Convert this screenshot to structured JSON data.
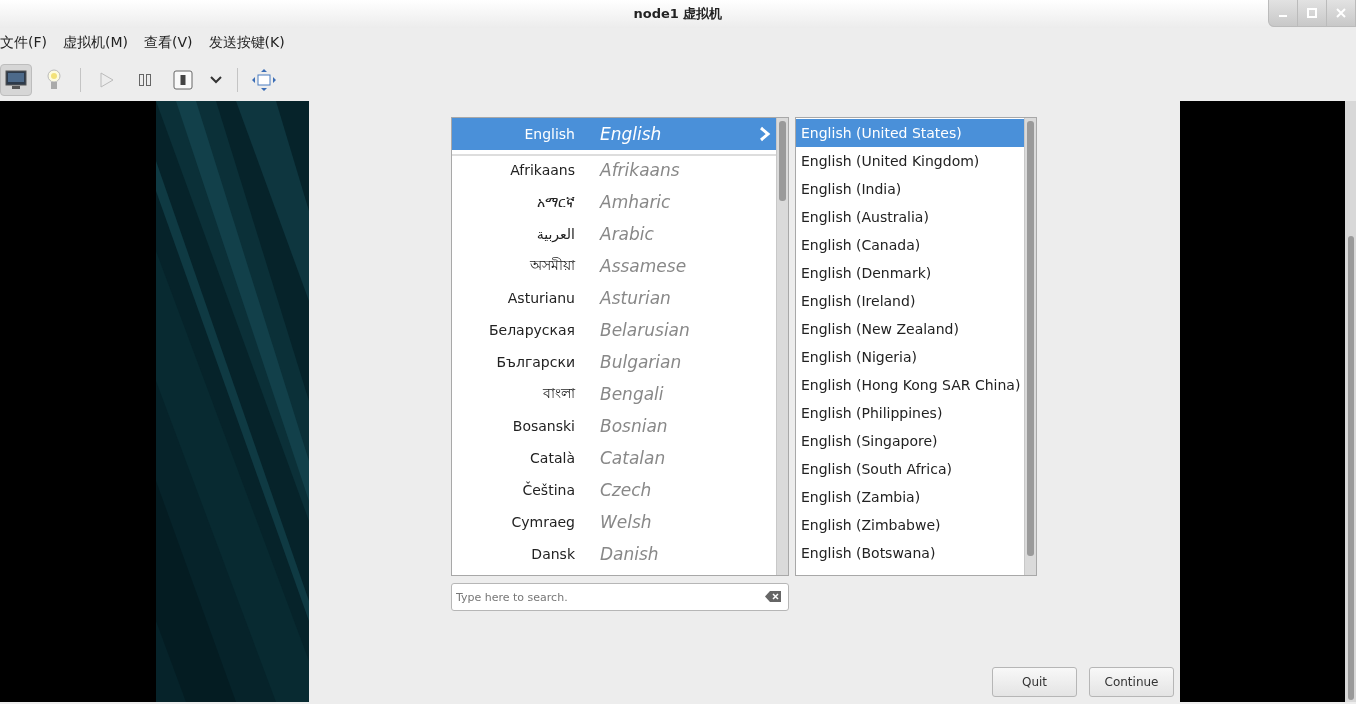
{
  "window": {
    "title": "node1 虚拟机"
  },
  "menu": [
    {
      "label": "文件(F)"
    },
    {
      "label": "虚拟机(M)"
    },
    {
      "label": "查看(V)"
    },
    {
      "label": "发送按键(K)"
    }
  ],
  "toolbar": [
    {
      "items": [
        {
          "kind": "monitor",
          "selected": true
        },
        {
          "kind": "bulb",
          "selected": false
        }
      ]
    },
    {
      "items": [
        {
          "kind": "play",
          "selected": false
        },
        {
          "kind": "pause",
          "selected": false
        },
        {
          "kind": "power",
          "selected": false
        },
        {
          "kind": "dropdown",
          "selected": false
        }
      ]
    },
    {
      "items": [
        {
          "kind": "fullscreen",
          "selected": false
        }
      ]
    }
  ],
  "languages": [
    {
      "native": "English",
      "english": "English",
      "selected": true
    },
    {
      "native": "Afrikaans",
      "english": "Afrikaans",
      "selected": false
    },
    {
      "native": "አማርኛ",
      "english": "Amharic",
      "selected": false
    },
    {
      "native": "العربية",
      "english": "Arabic",
      "selected": false
    },
    {
      "native": "অসমীয়া",
      "english": "Assamese",
      "selected": false
    },
    {
      "native": "Asturianu",
      "english": "Asturian",
      "selected": false
    },
    {
      "native": "Беларуская",
      "english": "Belarusian",
      "selected": false
    },
    {
      "native": "Български",
      "english": "Bulgarian",
      "selected": false
    },
    {
      "native": "বাংলা",
      "english": "Bengali",
      "selected": false
    },
    {
      "native": "Bosanski",
      "english": "Bosnian",
      "selected": false
    },
    {
      "native": "Català",
      "english": "Catalan",
      "selected": false
    },
    {
      "native": "Čeština",
      "english": "Czech",
      "selected": false
    },
    {
      "native": "Cymraeg",
      "english": "Welsh",
      "selected": false
    },
    {
      "native": "Dansk",
      "english": "Danish",
      "selected": false
    }
  ],
  "locales": [
    {
      "label": "English (United States)",
      "selected": true
    },
    {
      "label": "English (United Kingdom)",
      "selected": false
    },
    {
      "label": "English (India)",
      "selected": false
    },
    {
      "label": "English (Australia)",
      "selected": false
    },
    {
      "label": "English (Canada)",
      "selected": false
    },
    {
      "label": "English (Denmark)",
      "selected": false
    },
    {
      "label": "English (Ireland)",
      "selected": false
    },
    {
      "label": "English (New Zealand)",
      "selected": false
    },
    {
      "label": "English (Nigeria)",
      "selected": false
    },
    {
      "label": "English (Hong Kong SAR China)",
      "selected": false
    },
    {
      "label": "English (Philippines)",
      "selected": false
    },
    {
      "label": "English (Singapore)",
      "selected": false
    },
    {
      "label": "English (South Africa)",
      "selected": false
    },
    {
      "label": "English (Zambia)",
      "selected": false
    },
    {
      "label": "English (Zimbabwe)",
      "selected": false
    },
    {
      "label": "English (Botswana)",
      "selected": false
    }
  ],
  "search": {
    "placeholder": "Type here to search."
  },
  "buttons": [
    {
      "label": "Quit"
    },
    {
      "label": "Continue"
    }
  ]
}
